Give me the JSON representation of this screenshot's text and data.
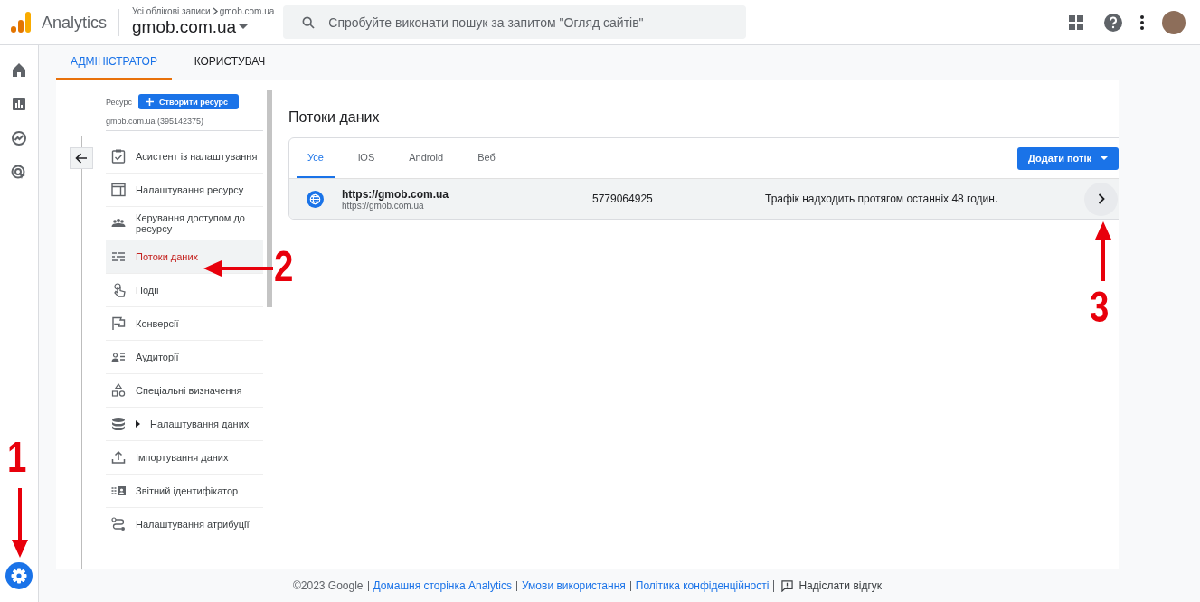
{
  "topbar": {
    "product": "Analytics",
    "breadcrumb": [
      "Усі облікові записи",
      "gmob.com.ua"
    ],
    "property": "gmob.com.ua",
    "search": {
      "placeholder": "Спробуйте виконати пошук за запитом \"Огляд сайтів\""
    }
  },
  "rail": {
    "items": [
      {
        "selected": false
      },
      {
        "selected": false
      },
      {
        "selected": false
      },
      {
        "selected": false
      }
    ],
    "settings": {
      "selected": true
    }
  },
  "tabs": [
    {
      "label": "АДМІНІСТРАТОР",
      "selected": true
    },
    {
      "label": "КОРИСТУВАЧ",
      "selected": false
    }
  ],
  "menu": {
    "resource_label": "Ресурс",
    "create_button": "Створити ресурс",
    "property_id": "gmob.com.ua (395142375)",
    "items": [
      {
        "label": "Асистент із налаштування",
        "kind": "page",
        "selected": false
      },
      {
        "label": "Налаштування ресурсу",
        "kind": "page",
        "selected": false
      },
      {
        "label": "Керування доступом до ресурсу",
        "kind": "page",
        "selected": false
      },
      {
        "label": "Потоки даних",
        "kind": "page",
        "selected": true
      },
      {
        "label": "Події",
        "kind": "page",
        "selected": false
      },
      {
        "label": "Конверсії",
        "kind": "page",
        "selected": false
      },
      {
        "label": "Аудиторії",
        "kind": "page",
        "selected": false
      },
      {
        "label": "Спеціальні визначення",
        "kind": "page",
        "selected": false
      },
      {
        "label": "Налаштування даних",
        "kind": "group",
        "selected": false,
        "expanded": false
      },
      {
        "label": "Імпортування даних",
        "kind": "page",
        "selected": false
      },
      {
        "label": "Звітний ідентифікатор",
        "kind": "page",
        "selected": false
      },
      {
        "label": "Налаштування атрибуції",
        "kind": "page",
        "selected": false
      }
    ]
  },
  "streams": {
    "title": "Потоки даних",
    "tabs": [
      {
        "label": "Усе",
        "selected": true
      },
      {
        "label": "iOS",
        "selected": false
      },
      {
        "label": "Android",
        "selected": false
      },
      {
        "label": "Веб",
        "selected": false
      }
    ],
    "add_button": "Додати потік",
    "rows": [
      {
        "name": "https://gmob.com.ua",
        "url": "https://gmob.com.ua",
        "stream_id": "5779064925",
        "status": "Трафік надходить протягом останніх 48 годин."
      }
    ]
  },
  "footer": {
    "copyright": "©2023 Google",
    "links": [
      "Домашня сторінка Analytics",
      "Умови використання",
      "Політика конфіденційності"
    ],
    "feedback": "Надіслати відгук"
  },
  "annotations": [
    {
      "label": "1",
      "kind": "down"
    },
    {
      "label": "2",
      "kind": "left"
    },
    {
      "label": "3",
      "kind": "up"
    }
  ]
}
